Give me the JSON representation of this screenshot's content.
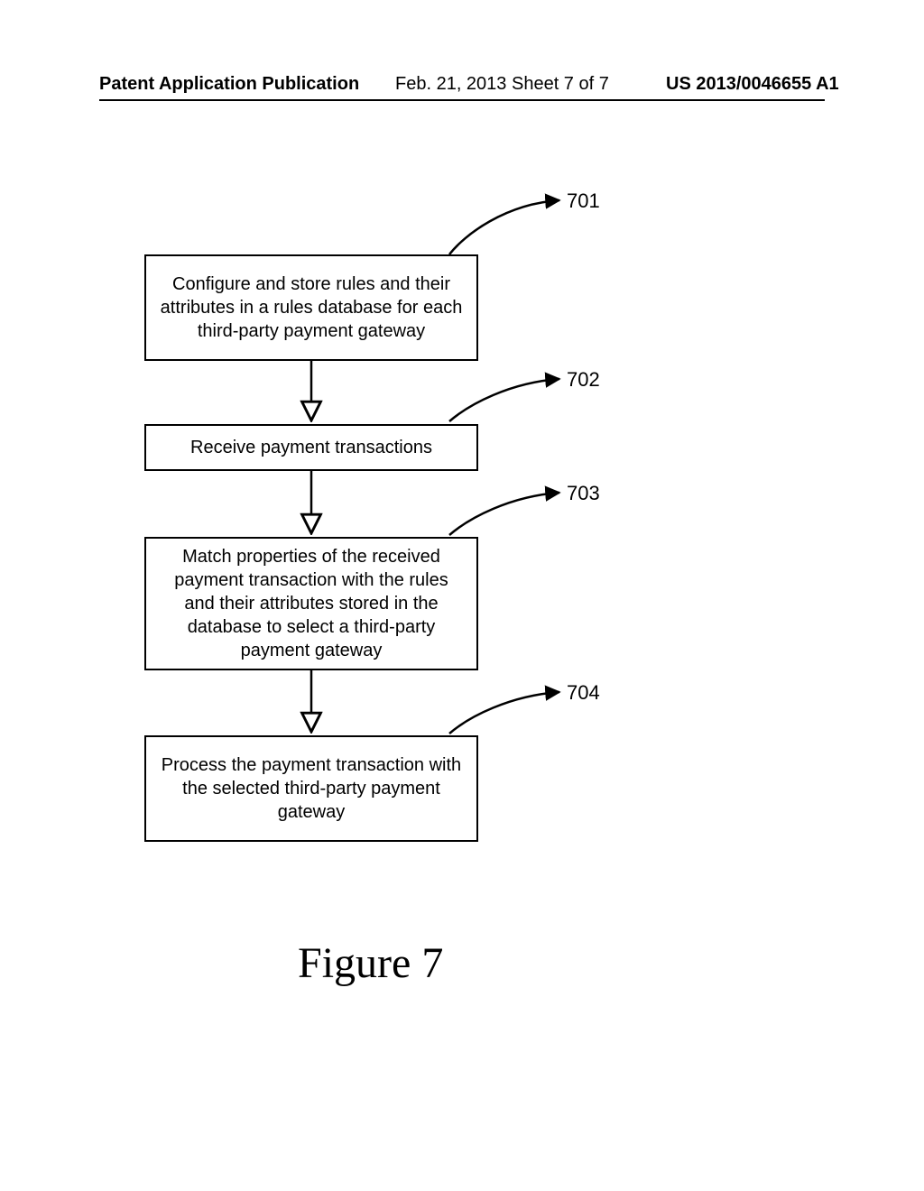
{
  "header": {
    "left": "Patent Application Publication",
    "middle": "Feb. 21, 2013  Sheet 7 of 7",
    "right": "US 2013/0046655 A1"
  },
  "flow": {
    "box1": {
      "text": "Configure and store rules and their attributes in a rules database for each third-party payment gateway",
      "ref": "701"
    },
    "box2": {
      "text": "Receive payment transactions",
      "ref": "702"
    },
    "box3": {
      "text": "Match properties of the received payment transaction with the rules and their attributes stored in the database to select a third-party payment gateway",
      "ref": "703"
    },
    "box4": {
      "text": "Process the payment transaction with the selected third-party payment gateway",
      "ref": "704"
    }
  },
  "figure_caption": "Figure 7"
}
